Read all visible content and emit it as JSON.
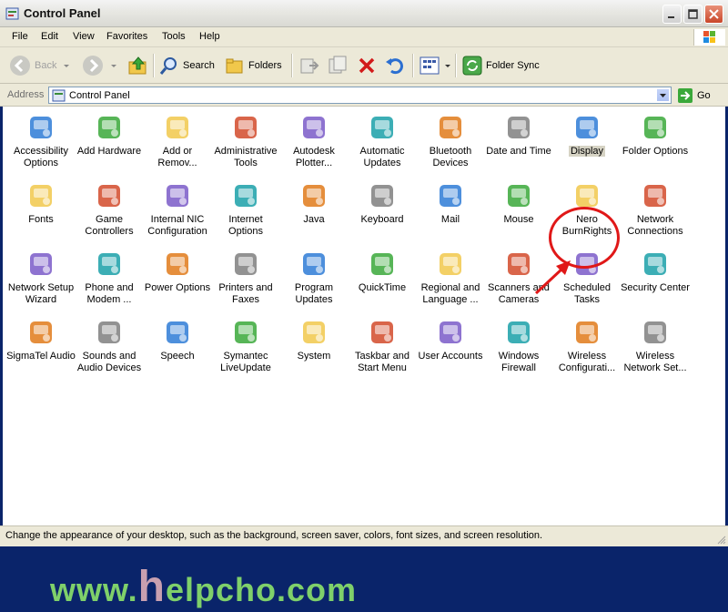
{
  "window": {
    "title": "Control Panel"
  },
  "menu": [
    "File",
    "Edit",
    "View",
    "Favorites",
    "Tools",
    "Help"
  ],
  "toolbar": {
    "back_label": "Back",
    "search_label": "Search",
    "folders_label": "Folders",
    "folder_sync_label": "Folder Sync"
  },
  "address": {
    "label": "Address",
    "value": "Control Panel",
    "go_label": "Go"
  },
  "items": [
    {
      "label": "Accessibility Options",
      "icon": "accessibility-icon"
    },
    {
      "label": "Add Hardware",
      "icon": "add-hardware-icon"
    },
    {
      "label": "Add or Remov...",
      "icon": "add-remove-programs-icon"
    },
    {
      "label": "Administrative Tools",
      "icon": "administrative-tools-icon"
    },
    {
      "label": "Autodesk Plotter...",
      "icon": "autodesk-plotter-icon"
    },
    {
      "label": "Automatic Updates",
      "icon": "automatic-updates-icon"
    },
    {
      "label": "Bluetooth Devices",
      "icon": "bluetooth-icon"
    },
    {
      "label": "Date and Time",
      "icon": "date-time-icon"
    },
    {
      "label": "Display",
      "icon": "display-icon"
    },
    {
      "label": "Folder Options",
      "icon": "folder-options-icon"
    },
    {
      "label": "Fonts",
      "icon": "fonts-icon"
    },
    {
      "label": "Game Controllers",
      "icon": "game-controller-icon"
    },
    {
      "label": "Internal NIC Configuration",
      "icon": "network-nic-icon"
    },
    {
      "label": "Internet Options",
      "icon": "internet-options-icon"
    },
    {
      "label": "Java",
      "icon": "java-icon"
    },
    {
      "label": "Keyboard",
      "icon": "keyboard-icon"
    },
    {
      "label": "Mail",
      "icon": "mail-icon"
    },
    {
      "label": "Mouse",
      "icon": "mouse-icon"
    },
    {
      "label": "Nero BurnRights",
      "icon": "nero-icon"
    },
    {
      "label": "Network Connections",
      "icon": "network-connections-icon"
    },
    {
      "label": "Network Setup Wizard",
      "icon": "network-setup-icon"
    },
    {
      "label": "Phone and Modem ...",
      "icon": "phone-modem-icon"
    },
    {
      "label": "Power Options",
      "icon": "power-options-icon"
    },
    {
      "label": "Printers and Faxes",
      "icon": "printer-icon"
    },
    {
      "label": "Program Updates",
      "icon": "program-updates-icon"
    },
    {
      "label": "QuickTime",
      "icon": "quicktime-icon"
    },
    {
      "label": "Regional and Language ...",
      "icon": "regional-globe-icon"
    },
    {
      "label": "Scanners and Cameras",
      "icon": "scanner-camera-icon"
    },
    {
      "label": "Scheduled Tasks",
      "icon": "scheduled-tasks-icon"
    },
    {
      "label": "Security Center",
      "icon": "security-shield-icon"
    },
    {
      "label": "SigmaTel Audio",
      "icon": "sigmatel-audio-icon"
    },
    {
      "label": "Sounds and Audio Devices",
      "icon": "speaker-icon"
    },
    {
      "label": "Speech",
      "icon": "speech-icon"
    },
    {
      "label": "Symantec LiveUpdate",
      "icon": "liveupdate-icon"
    },
    {
      "label": "System",
      "icon": "system-icon"
    },
    {
      "label": "Taskbar and Start Menu",
      "icon": "taskbar-icon"
    },
    {
      "label": "User Accounts",
      "icon": "user-accounts-icon"
    },
    {
      "label": "Windows Firewall",
      "icon": "firewall-icon"
    },
    {
      "label": "Wireless Configurati...",
      "icon": "wireless-antenna-icon"
    },
    {
      "label": "Wireless Network Set...",
      "icon": "wireless-network-icon"
    }
  ],
  "selected_item": "Display",
  "watermark": {
    "pre": "www.",
    "h": "h",
    "post": "elpcho.com"
  },
  "status": "Change the appearance of your desktop, such as the background, screen saver, colors, font sizes, and screen resolution."
}
